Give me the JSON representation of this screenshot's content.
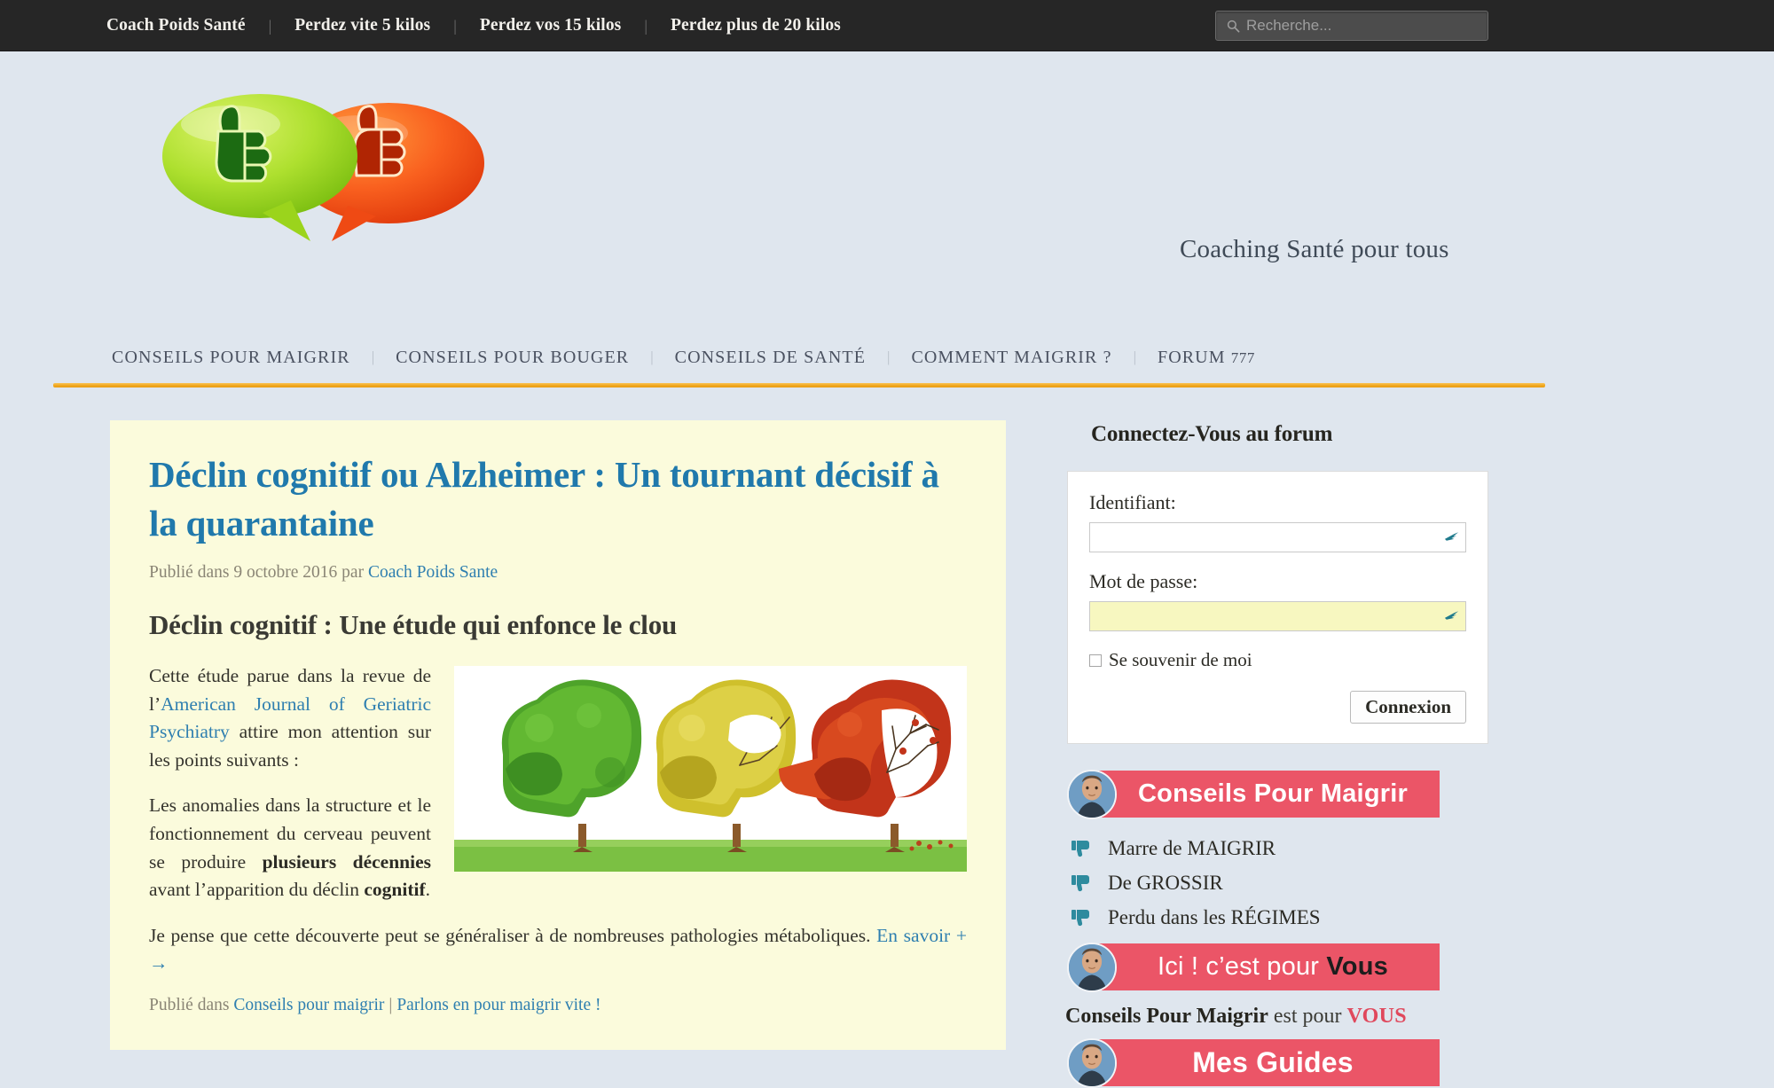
{
  "topbar": {
    "nav": [
      {
        "label": "Coach Poids Santé"
      },
      {
        "label": "Perdez vite 5 kilos"
      },
      {
        "label": "Perdez vos 15 kilos"
      },
      {
        "label": "Perdez plus de 20 kilos"
      }
    ],
    "separator": "|",
    "search": {
      "placeholder": "Recherche...",
      "value": "",
      "icon": "search-icon"
    }
  },
  "masthead": {
    "logo_icon": "thumbs-up-down-speech-bubbles-logo",
    "tagline": "Coaching Santé pour tous"
  },
  "mainnav": {
    "separator": "|",
    "items": [
      {
        "label": "CONSEILS POUR MAIGRIR",
        "count": ""
      },
      {
        "label": "CONSEILS POUR BOUGER",
        "count": ""
      },
      {
        "label": "CONSEILS DE SANTÉ",
        "count": ""
      },
      {
        "label": "COMMENT MAIGRIR ?",
        "count": ""
      },
      {
        "label": "FORUM",
        "count": "777"
      }
    ]
  },
  "article": {
    "title": "Déclin cognitif ou Alzheimer : Un tournant décisif à la quarantaine",
    "byline_prefix": "Publié dans 9 octobre 2016 par",
    "byline_author": "Coach Poids Sante",
    "subtitle": "Déclin cognitif : Une étude qui enfonce le clou",
    "figure_alt": "three-head-shaped-trees-green-yellow-red",
    "p1_a": "Cette étude parue dans la revue de l’",
    "p1_link": "American Journal of Geriatric Psychiatry",
    "p1_b": " attire mon attention sur les points suivants :",
    "p2_a": "Les anomalies dans la structure et le fonctionnement du cerveau peuvent se produire ",
    "p2_bold1": "plusieurs décennies",
    "p2_b": " avant l’apparition du déclin ",
    "p2_bold2": "cognitif",
    "p2_c": ".",
    "p3_a": "Je pense que cette découverte peut se généraliser à de nombreuses pathologies métaboliques. ",
    "p3_link": "En savoir + →",
    "footer_prefix": "Publié dans",
    "footer_link1": "Conseils pour maigrir",
    "footer_sep": "|",
    "footer_link2": "Parlons en pour maigrir vite !"
  },
  "sidebar": {
    "login_title": "Connectez-Vous au forum",
    "login": {
      "user_label": "Identifiant:",
      "user_value": "",
      "password_label": "Mot de passe:",
      "password_value": "",
      "remember_label": "Se souvenir de moi",
      "submit_label": "Connexion",
      "field_icon": "key-autofill-icon"
    },
    "banner1": {
      "text": "Conseils Pour Maigrir",
      "avatar_icon": "avatar-photo",
      "color": "#eb5567"
    },
    "bullets": [
      {
        "icon": "thumbs-down-icon",
        "label": "Marre de MAIGRIR"
      },
      {
        "icon": "thumbs-down-icon",
        "label": "De GROSSIR"
      },
      {
        "icon": "thumbs-down-icon",
        "label": "Perdu dans les RÉGIMES"
      }
    ],
    "banner2": {
      "text_light": "Ici ! c’est pour ",
      "text_dark": "Vous",
      "avatar_icon": "avatar-photo",
      "color": "#eb5567"
    },
    "promo": {
      "bold": "Conseils Pour Maigrir",
      "mid": " est pour ",
      "red": "VOUS"
    },
    "banner3": {
      "text": "Mes Guides",
      "avatar_icon": "avatar-photo",
      "color": "#eb5567"
    }
  },
  "colors": {
    "page_bg": "#dfe6ee",
    "topbar_bg": "#262626",
    "article_bg": "#fbfbdc",
    "accent_orange": "#f0a81f",
    "link_blue": "#2f7fb0",
    "title_blue": "#2079ac",
    "banner_pink": "#eb5567"
  }
}
